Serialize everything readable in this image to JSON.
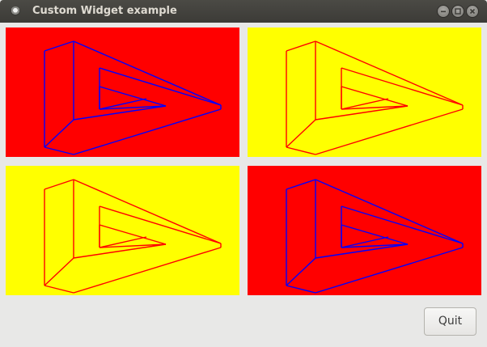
{
  "window": {
    "title": "Custom Widget example"
  },
  "titlebar_buttons": [
    {
      "name": "minimize",
      "icon": "minimize-icon"
    },
    {
      "name": "maximize",
      "icon": "maximize-icon"
    },
    {
      "name": "close",
      "icon": "close-icon"
    }
  ],
  "widgets": [
    {
      "background": "#ff0000",
      "stroke": "#0000ff",
      "mirrored": false
    },
    {
      "background": "#ffff00",
      "stroke": "#ff0000",
      "mirrored": false
    },
    {
      "background": "#ffff00",
      "stroke": "#ff0000",
      "mirrored": false
    },
    {
      "background": "#ff0000",
      "stroke": "#0000ff",
      "mirrored": false
    }
  ],
  "footer": {
    "quit_label": "Quit"
  },
  "colors": {
    "titlebar": "#3c3b37",
    "title_text": "#dfdbd2",
    "window_bg": "#e8e8e7",
    "red": "#ff0000",
    "yellow": "#ffff00",
    "blue": "#0000ff"
  }
}
